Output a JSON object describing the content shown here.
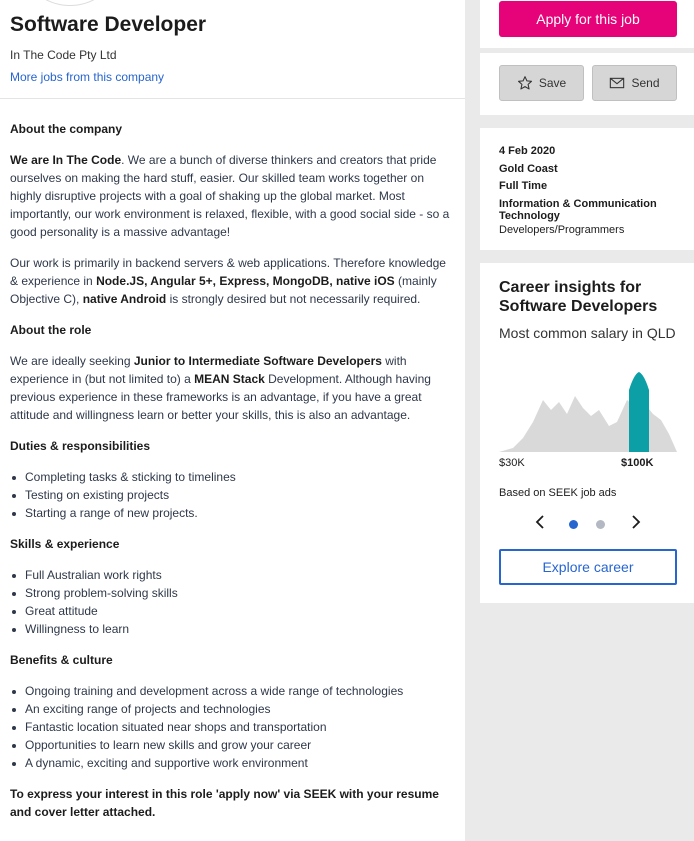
{
  "job": {
    "title": "Software Developer",
    "company": "In The Code Pty Ltd",
    "more_jobs": "More jobs from this company"
  },
  "description": {
    "about_company_heading": "About the company",
    "about_p1_bold": "We are In The Code",
    "about_p1_rest": ". We are a bunch of diverse thinkers and creators that pride ourselves on making the hard stuff, easier. Our skilled team works together on highly disruptive projects with a goal of shaking up the global market.  Most importantly, our work environment is relaxed, flexible, with a good social side - so a good personality is a massive advantage!",
    "about_p2_a": "Our work is primarily in backend servers & web applications. Therefore knowledge & experience in ",
    "about_p2_b": "Node.JS, Angular 5+, Express, MongoDB, native iOS",
    "about_p2_c": " (mainly Objective C), ",
    "about_p2_d": "native Android",
    "about_p2_e": " is strongly desired but not necessarily required.",
    "role_heading": "About the role",
    "role_a": "We are ideally seeking ",
    "role_b": "Junior to Intermediate Software Developers",
    "role_c": " with experience in (but not limited to) a ",
    "role_d": "MEAN Stack",
    "role_e": " Development. Although having previous experience in these frameworks is an advantage, if you have a great attitude and willingness learn or better your skills, this is also an advantage.",
    "duties_heading": "Duties & responsibilities",
    "duties": [
      "Completing tasks & sticking to timelines",
      "Testing on existing projects",
      "Starting a range of new projects."
    ],
    "skills_heading": "Skills & experience",
    "skills": [
      "Full Australian work rights",
      "Strong problem-solving skills",
      "Great attitude",
      "Willingness to learn"
    ],
    "benefits_heading": "Benefits & culture",
    "benefits": [
      "Ongoing training and development across a wide range of technologies",
      "An exciting range of projects and technologies",
      "Fantastic location situated near shops and transportation",
      "Opportunities to learn new skills and grow your career",
      "A dynamic, exciting and supportive work environment"
    ],
    "closing": "To express your interest in this role 'apply now' via SEEK with your resume and cover letter attached."
  },
  "sidebar": {
    "apply_label": "Apply for this job",
    "save_label": "Save",
    "send_label": "Send",
    "date": "4 Feb 2020",
    "location": "Gold Coast",
    "work_type": "Full Time",
    "classification": "Information & Communication Technology",
    "subclassification": "Developers/Programmers",
    "insights_title": "Career insights for Software Developers",
    "insights_subtitle": "Most common salary in QLD",
    "based_on": "Based on SEEK job ads",
    "explore_label": "Explore career",
    "prev_icon": "chevron-left-icon",
    "next_icon": "chevron-right-icon"
  },
  "colors": {
    "apply": "#e60278",
    "link": "#2765cf",
    "highlight": "#0d9fa6",
    "distribution": "#d9d9d9"
  },
  "chart_data": {
    "type": "area",
    "ticks": [
      "$30K",
      "$100K"
    ],
    "highlight_label": "$100K"
  }
}
